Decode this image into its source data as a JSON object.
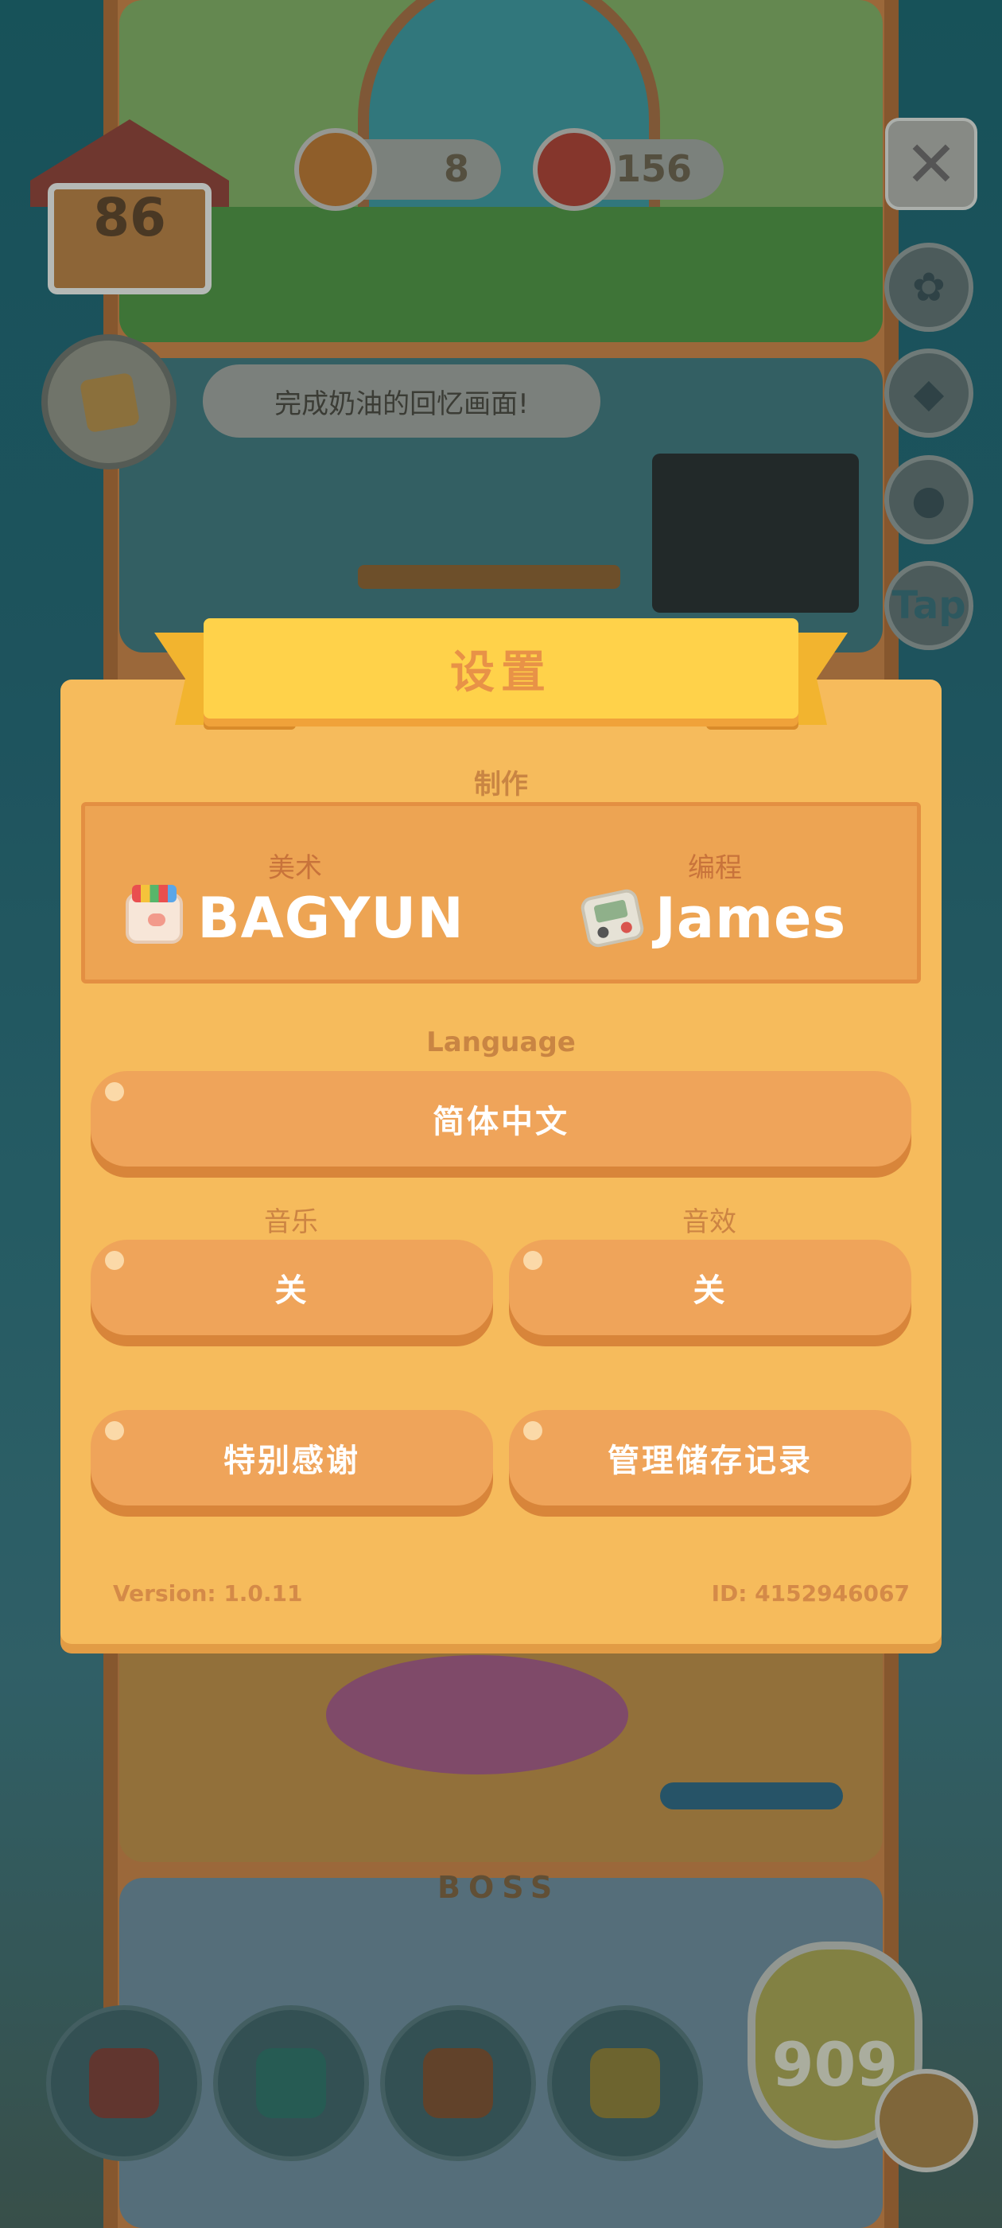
{
  "hud": {
    "house_level": "86",
    "resource_1": "8",
    "resource_2": "156",
    "quest_text": "完成奶油的回忆画面!",
    "side_tap_label": "Tap",
    "boss_label": "BOSS",
    "coins": "909"
  },
  "settings": {
    "title": "设置",
    "credits_title": "制作",
    "credits": [
      {
        "role": "美术",
        "name": "BAGYUN",
        "icon": "cat-lunchbox-icon"
      },
      {
        "role": "编程",
        "name": "James",
        "icon": "gameboy-icon"
      }
    ],
    "language_title": "Language",
    "language_value": "简体中文",
    "music_label": "音乐",
    "music_value": "关",
    "sfx_label": "音效",
    "sfx_value": "关",
    "special_thanks": "特别感谢",
    "manage_saves": "管理储存记录",
    "version": "Version: 1.0.11",
    "id": "ID: 4152946067"
  },
  "colors": {
    "dialog_bg": "#f6bb5c",
    "ribbon": "#ffd24a",
    "button": "#efa45a",
    "title_text": "#e89247"
  }
}
